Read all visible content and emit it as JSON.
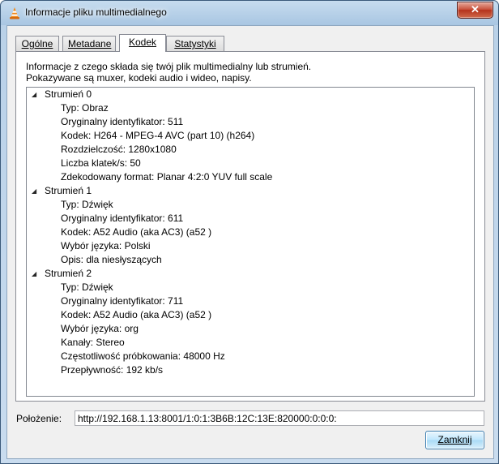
{
  "window": {
    "title": "Informacje pliku multimedialnego",
    "close_glyph": "✕",
    "icon": "vlc-cone-icon"
  },
  "tabs": [
    {
      "label": "Ogólne",
      "active": false
    },
    {
      "label": "Metadane",
      "active": false
    },
    {
      "label": "Kodek",
      "active": true
    },
    {
      "label": "Statystyki",
      "active": false
    }
  ],
  "panel": {
    "info_line1": "Informacje z czego składa się twój plik multimedialny lub strumień.",
    "info_line2": "Pokazywane są muxer, kodeki audio i wideo, napisy."
  },
  "streams": [
    {
      "title": "Strumień 0",
      "expanded": true,
      "props": [
        "Typ: Obraz",
        "Oryginalny identyfikator: 511",
        "Kodek: H264 - MPEG-4 AVC (part 10) (h264)",
        "Rozdzielczość: 1280x1080",
        "Liczba klatek/s: 50",
        "Zdekodowany format: Planar 4:2:0 YUV full scale"
      ]
    },
    {
      "title": "Strumień 1",
      "expanded": true,
      "props": [
        "Typ: Dźwięk",
        "Oryginalny identyfikator: 611",
        "Kodek: A52 Audio (aka AC3) (a52 )",
        "Wybór języka: Polski",
        "Opis: dla niesłyszących"
      ]
    },
    {
      "title": "Strumień 2",
      "expanded": true,
      "props": [
        "Typ: Dźwięk",
        "Oryginalny identyfikator: 711",
        "Kodek: A52 Audio (aka AC3) (a52 )",
        "Wybór języka: org",
        "Kanały: Stereo",
        "Częstotliwość próbkowania: 48000 Hz",
        "Przepływność: 192 kb/s"
      ]
    }
  ],
  "location": {
    "label": "Położenie:",
    "value": "http://192.168.1.13:8001/1:0:1:3B6B:12C:13E:820000:0:0:0:"
  },
  "buttons": {
    "close_label": "Zamknij"
  }
}
